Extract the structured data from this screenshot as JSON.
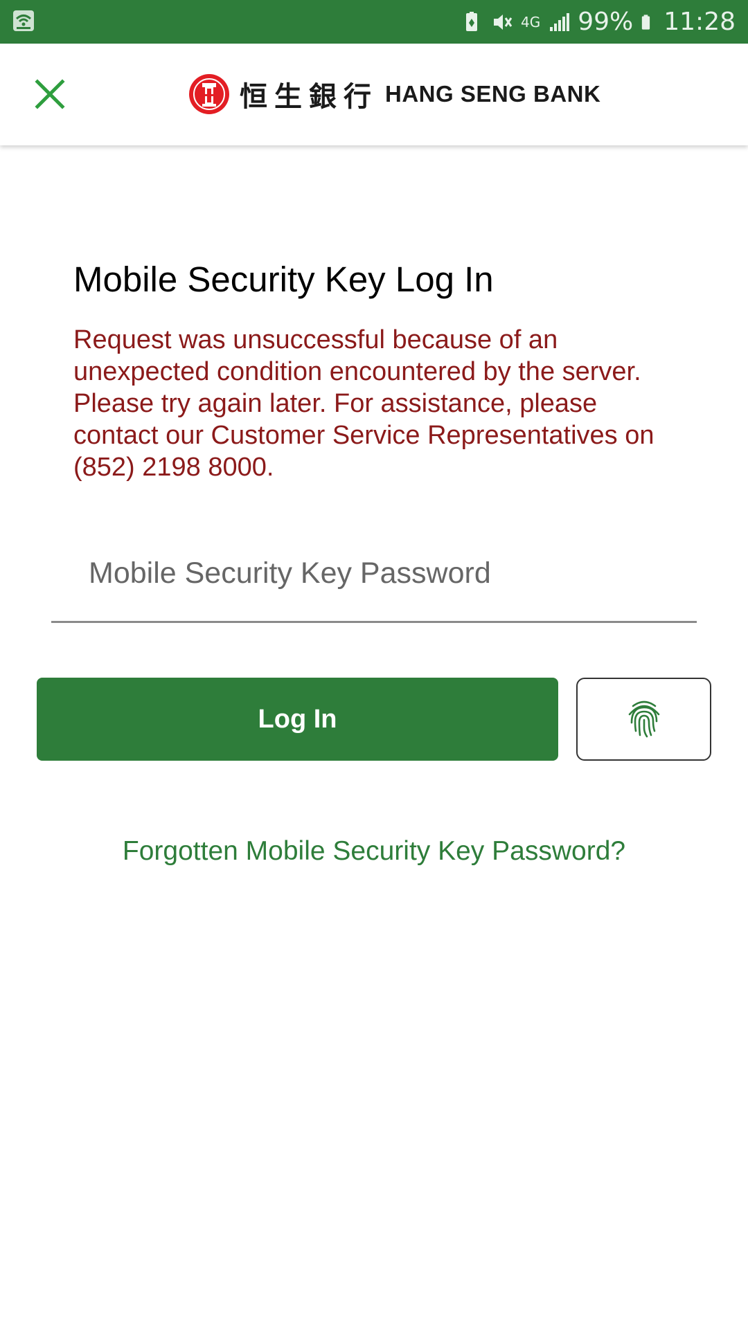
{
  "status_bar": {
    "battery_percent": "99%",
    "time": "11:28",
    "network": "4G",
    "icons": [
      "wifi-calling-icon",
      "battery-saver-icon",
      "mute-icon",
      "4g-data-icon",
      "signal-icon",
      "battery-icon"
    ]
  },
  "app_bar": {
    "close_icon": "close-icon",
    "brand_chinese": "恒生銀行",
    "brand_english": "HANG SENG BANK",
    "brand_color": "#e31e24"
  },
  "main": {
    "title": "Mobile Security Key Log In",
    "error_message": "Request was unsuccessful because of an unexpected condition encountered by the server. Please try again later. For assistance, please contact our Customer Service Representatives on (852) 2198 8000.",
    "password_placeholder": "Mobile Security Key Password",
    "password_value": "",
    "login_label": "Log In",
    "fingerprint_icon": "fingerprint-icon",
    "forgot_link": "Forgotten Mobile Security Key Password?"
  },
  "colors": {
    "primary_green": "#2e7d3a",
    "error_red": "#8b1a1a",
    "brand_red": "#e31e24"
  }
}
